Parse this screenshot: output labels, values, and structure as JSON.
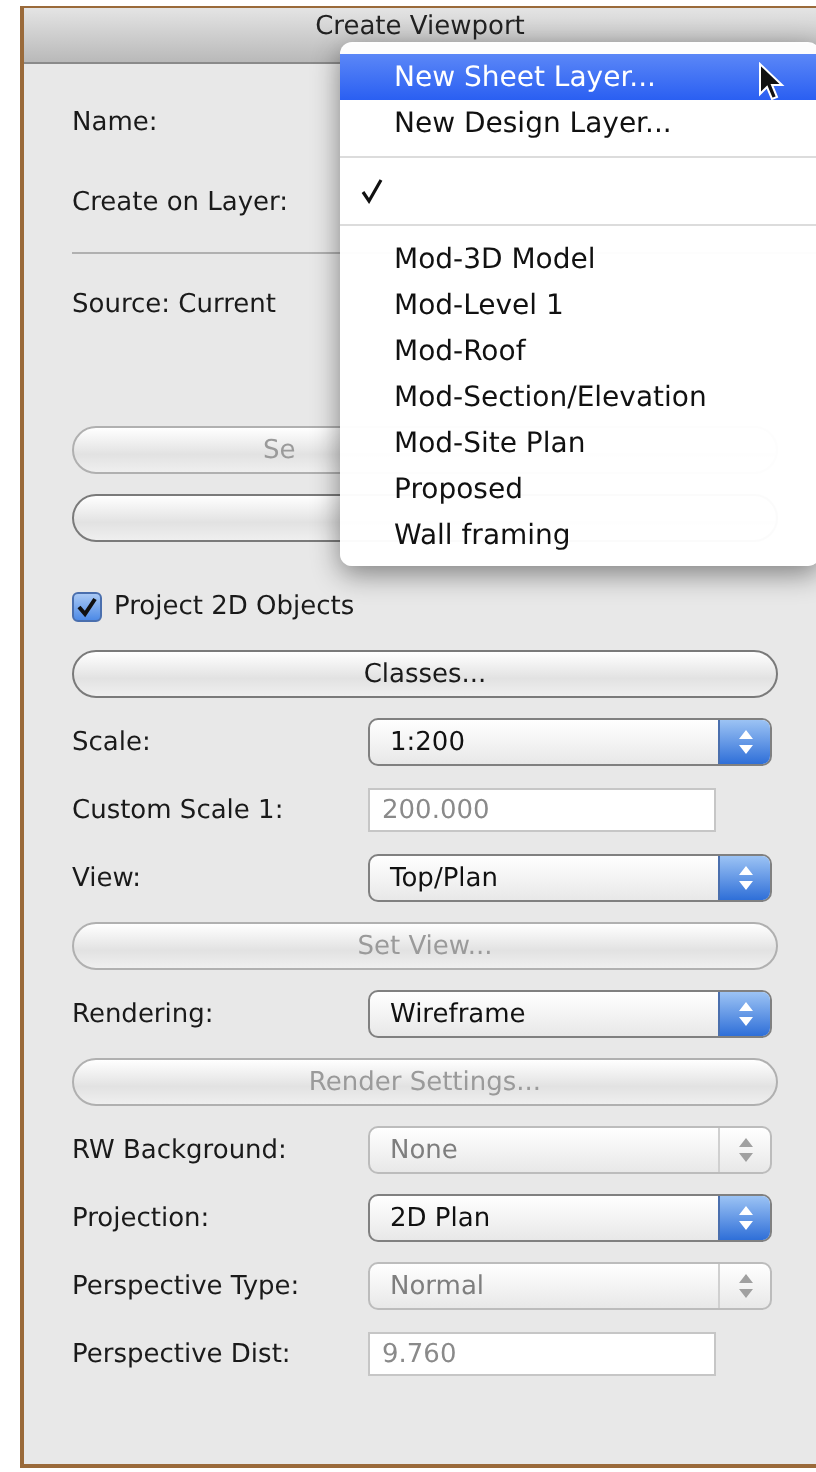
{
  "window": {
    "title": "Create Viewport"
  },
  "form": [
    {
      "kind": "label",
      "label": "Name:"
    },
    {
      "kind": "label",
      "label": "Create on Layer:"
    },
    {
      "kind": "divider"
    },
    {
      "kind": "text",
      "label": "Source: Current"
    },
    {
      "kind": "button",
      "label": "Se",
      "disabled": true,
      "covered": true
    },
    {
      "kind": "button",
      "disabled": false
    },
    {
      "kind": "checkbox",
      "label": "Project 2D Objects",
      "checked": true
    },
    {
      "kind": "button",
      "label": "Classes...",
      "disabled": false
    },
    {
      "kind": "popup",
      "label": "Scale:",
      "value": "1:200",
      "disabled": false
    },
    {
      "kind": "field",
      "label": "Custom Scale 1:",
      "value": "200.000",
      "disabled": true
    },
    {
      "kind": "popup",
      "label": "View:",
      "value": "Top/Plan",
      "disabled": false
    },
    {
      "kind": "button",
      "label": "Set View...",
      "disabled": true
    },
    {
      "kind": "popup",
      "label": "Rendering:",
      "value": "Wireframe",
      "disabled": false
    },
    {
      "kind": "button",
      "label": "Render Settings...",
      "disabled": true
    },
    {
      "kind": "popup",
      "label": "RW Background:",
      "value": "None",
      "disabled": true
    },
    {
      "kind": "popup",
      "label": "Projection:",
      "value": "2D Plan",
      "disabled": false
    },
    {
      "kind": "popup",
      "label": "Perspective Type:",
      "value": "Normal",
      "disabled": true
    },
    {
      "kind": "field",
      "label": "Perspective Dist:",
      "value": "9.760",
      "disabled": true
    }
  ],
  "menu": [
    {
      "kind": "item",
      "label": "New Sheet Layer...",
      "selected": true
    },
    {
      "kind": "item",
      "label": "New Design Layer...",
      "selected": false
    },
    {
      "kind": "separator"
    },
    {
      "kind": "check",
      "checked": true
    },
    {
      "kind": "separator"
    },
    {
      "kind": "item",
      "label": "Mod-3D Model",
      "selected": false
    },
    {
      "kind": "item",
      "label": "Mod-Level 1",
      "selected": false
    },
    {
      "kind": "item",
      "label": "Mod-Roof",
      "selected": false
    },
    {
      "kind": "item",
      "label": "Mod-Section/Elevation",
      "selected": false
    },
    {
      "kind": "item",
      "label": "Mod-Site Plan",
      "selected": false
    },
    {
      "kind": "item",
      "label": "Proposed",
      "selected": false
    },
    {
      "kind": "item",
      "label": "Wall framing",
      "selected": false
    }
  ]
}
